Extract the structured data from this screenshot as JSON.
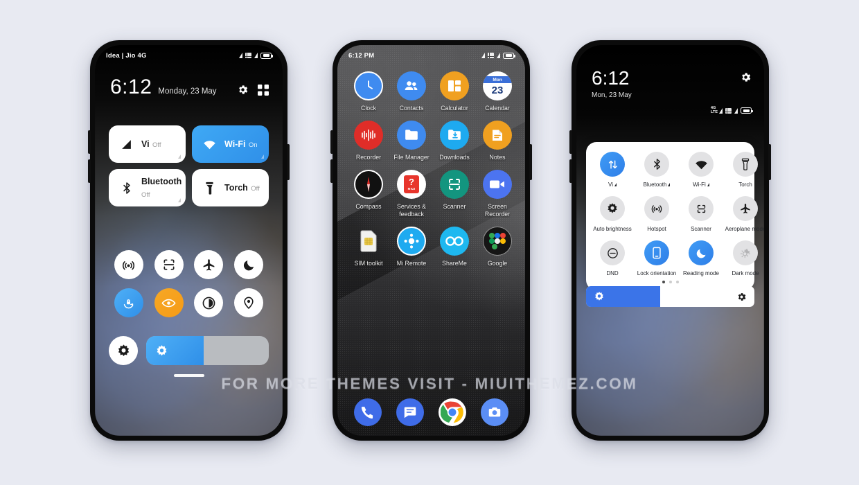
{
  "background_color": "#e8eaf2",
  "watermark": "FOR MORE THEMES VISIT - MIUITHEMEZ.COM",
  "accent_blue": "#2f8fe8",
  "accent_orange": "#f59b16",
  "phone1": {
    "name": "control-center",
    "statusbar": {
      "carrier": "Idea | Jio 4G",
      "battery": "52"
    },
    "header": {
      "time": "6:12",
      "date": "Monday, 23 May",
      "settings_icon": "gear-icon",
      "edit_icon": "add-tiles-icon"
    },
    "big_tiles": [
      {
        "label": "Vi",
        "state": "Off",
        "icon": "signal-icon",
        "on": false,
        "expandable": true
      },
      {
        "label": "Wi-Fi",
        "state": "On",
        "icon": "wifi-icon",
        "on": true,
        "expandable": true
      },
      {
        "label": "Bluetooth",
        "state": "Off",
        "icon": "bluetooth-icon",
        "on": false,
        "expandable": true
      },
      {
        "label": "Torch",
        "state": "Off",
        "icon": "torch-icon",
        "on": false,
        "expandable": false
      }
    ],
    "circle_tiles": [
      {
        "icon": "hotspot-icon",
        "state": "off"
      },
      {
        "icon": "scanner-icon",
        "state": "off"
      },
      {
        "icon": "aeroplane-icon",
        "state": "off"
      },
      {
        "icon": "dnd-moon-icon",
        "state": "off"
      },
      {
        "icon": "lock-orientation-icon",
        "state": "on-blue"
      },
      {
        "icon": "reading-mode-eye-icon",
        "state": "on-orange"
      },
      {
        "icon": "dark-mode-contrast-icon",
        "state": "off"
      },
      {
        "icon": "location-pin-icon",
        "state": "off"
      }
    ],
    "brightness": {
      "auto_icon": "auto-brightness-icon",
      "slider_icon": "brightness-icon",
      "percent": 47
    }
  },
  "phone2": {
    "name": "home-screen",
    "statusbar": {
      "time": "6:12 PM",
      "battery": "52"
    },
    "apps": [
      {
        "label": "Clock",
        "icon": "clock-icon"
      },
      {
        "label": "Contacts",
        "icon": "contacts-icon"
      },
      {
        "label": "Calculator",
        "icon": "calculator-icon"
      },
      {
        "label": "Calendar",
        "icon": "calendar-icon",
        "day_name": "Mon",
        "day_num": "23"
      },
      {
        "label": "Recorder",
        "icon": "recorder-icon"
      },
      {
        "label": "File Manager",
        "icon": "file-manager-icon"
      },
      {
        "label": "Downloads",
        "icon": "downloads-icon"
      },
      {
        "label": "Notes",
        "icon": "notes-icon"
      },
      {
        "label": "Compass",
        "icon": "compass-icon"
      },
      {
        "label": "Services & feedback",
        "icon": "services-feedback-icon"
      },
      {
        "label": "Scanner",
        "icon": "scanner-icon"
      },
      {
        "label": "Screen Recorder",
        "icon": "screen-recorder-icon"
      },
      {
        "label": "SIM toolkit",
        "icon": "sim-card-icon"
      },
      {
        "label": "Mi Remote",
        "icon": "mi-remote-icon"
      },
      {
        "label": "ShareMe",
        "icon": "shareme-icon"
      },
      {
        "label": "Google",
        "icon": "google-folder-icon"
      }
    ],
    "dock": [
      {
        "label": "Phone",
        "icon": "phone-icon"
      },
      {
        "label": "Messages",
        "icon": "messages-icon"
      },
      {
        "label": "Chrome",
        "icon": "chrome-icon"
      },
      {
        "label": "Camera",
        "icon": "camera-icon"
      }
    ]
  },
  "phone3": {
    "name": "notification-shade",
    "header": {
      "time": "6:12",
      "date": "Mon, 23 May",
      "settings_icon": "gear-icon"
    },
    "statusbar": {
      "battery": "52"
    },
    "tiles": [
      {
        "label": "Vi",
        "icon": "mobile-data-icon",
        "on": true,
        "expandable": true
      },
      {
        "label": "Bluetooth",
        "icon": "bluetooth-icon",
        "on": false,
        "expandable": true
      },
      {
        "label": "Wi-Fi",
        "icon": "wifi-icon",
        "on": false,
        "expandable": true
      },
      {
        "label": "Torch",
        "icon": "torch-icon",
        "on": false,
        "expandable": false
      },
      {
        "label": "Auto brightness",
        "icon": "auto-brightness-icon",
        "on": false,
        "expandable": false
      },
      {
        "label": "Hotspot",
        "icon": "hotspot-icon",
        "on": false,
        "expandable": false
      },
      {
        "label": "Scanner",
        "icon": "scanner-icon",
        "on": false,
        "expandable": false
      },
      {
        "label": "Aeroplane mode",
        "icon": "aeroplane-icon",
        "on": false,
        "expandable": false
      },
      {
        "label": "DND",
        "icon": "dnd-icon",
        "on": false,
        "expandable": false
      },
      {
        "label": "Lock orientation",
        "icon": "lock-orientation-icon",
        "on": true,
        "expandable": false
      },
      {
        "label": "Reading mode",
        "icon": "reading-mode-icon",
        "on": true,
        "expandable": false
      },
      {
        "label": "Dark mode",
        "icon": "dark-mode-icon",
        "on": false,
        "expandable": false
      }
    ],
    "pages": {
      "count": 3,
      "active": 1
    },
    "brightness": {
      "percent": 44,
      "icon": "brightness-icon",
      "settings_icon": "brightness-settings-icon"
    }
  }
}
